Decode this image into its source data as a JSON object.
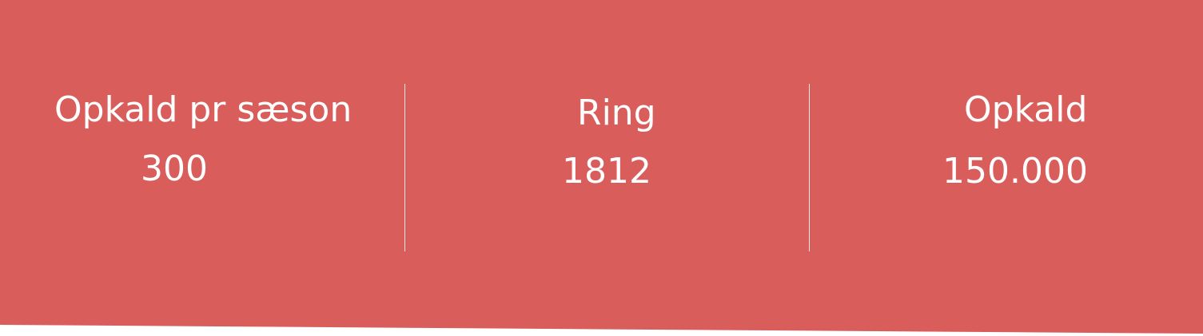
{
  "stats": [
    {
      "label": "Opkald pr sæson",
      "value": "300"
    },
    {
      "label": "Ring",
      "value": "1812"
    },
    {
      "label": "Opkald",
      "value": "150.000"
    }
  ],
  "colors": {
    "background": "#d85d5b",
    "text": "#ffffff"
  }
}
